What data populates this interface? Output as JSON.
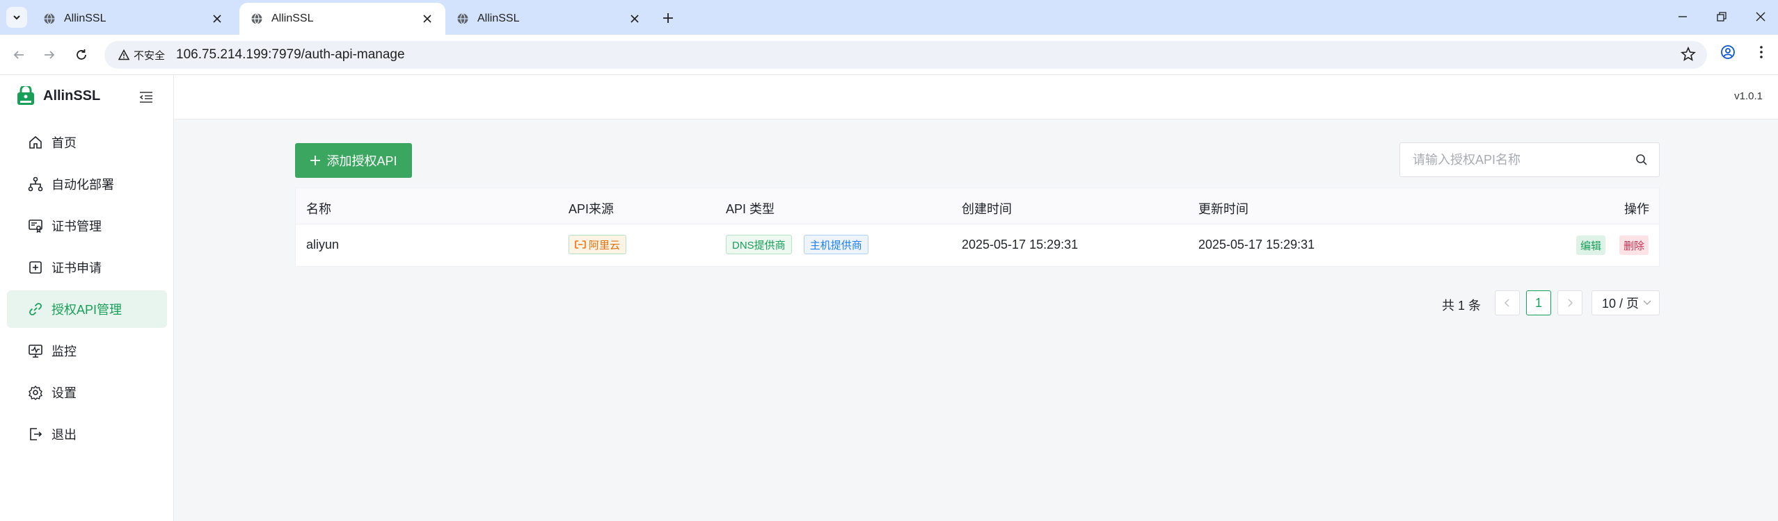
{
  "browser": {
    "tabs": [
      {
        "title": "AllinSSL",
        "active": false
      },
      {
        "title": "AllinSSL",
        "active": true
      },
      {
        "title": "AllinSSL",
        "active": false
      }
    ],
    "security_label": "不安全",
    "url_host": "106.75.214.199",
    "url_rest": ":7979/auth-api-manage"
  },
  "sidebar": {
    "brand": "AllinSSL",
    "items": [
      {
        "label": "首页",
        "icon": "home-icon"
      },
      {
        "label": "自动化部署",
        "icon": "workflow-icon"
      },
      {
        "label": "证书管理",
        "icon": "certificate-icon"
      },
      {
        "label": "证书申请",
        "icon": "plus-square-icon"
      },
      {
        "label": "授权API管理",
        "icon": "api-link-icon",
        "active": true
      },
      {
        "label": "监控",
        "icon": "monitor-icon"
      },
      {
        "label": "设置",
        "icon": "gear-icon"
      },
      {
        "label": "退出",
        "icon": "logout-icon"
      }
    ]
  },
  "header": {
    "version": "v1.0.1"
  },
  "toolbar": {
    "add_label": "添加授权API",
    "search_placeholder": "请输入授权API名称"
  },
  "table": {
    "columns": [
      "名称",
      "API来源",
      "API 类型",
      "创建时间",
      "更新时间",
      "操作"
    ],
    "rows": [
      {
        "name": "aliyun",
        "source": "阿里云",
        "types": [
          "DNS提供商",
          "主机提供商"
        ],
        "created": "2025-05-17 15:29:31",
        "updated": "2025-05-17 15:29:31",
        "actions": [
          "编辑",
          "删除"
        ]
      }
    ]
  },
  "pagination": {
    "total_label": "共 1 条",
    "current_page": "1",
    "page_size": "10 / 页"
  },
  "colors": {
    "accent": "#18a058",
    "danger": "#d03050",
    "info": "#2080f0",
    "warning": "#e0700b"
  }
}
